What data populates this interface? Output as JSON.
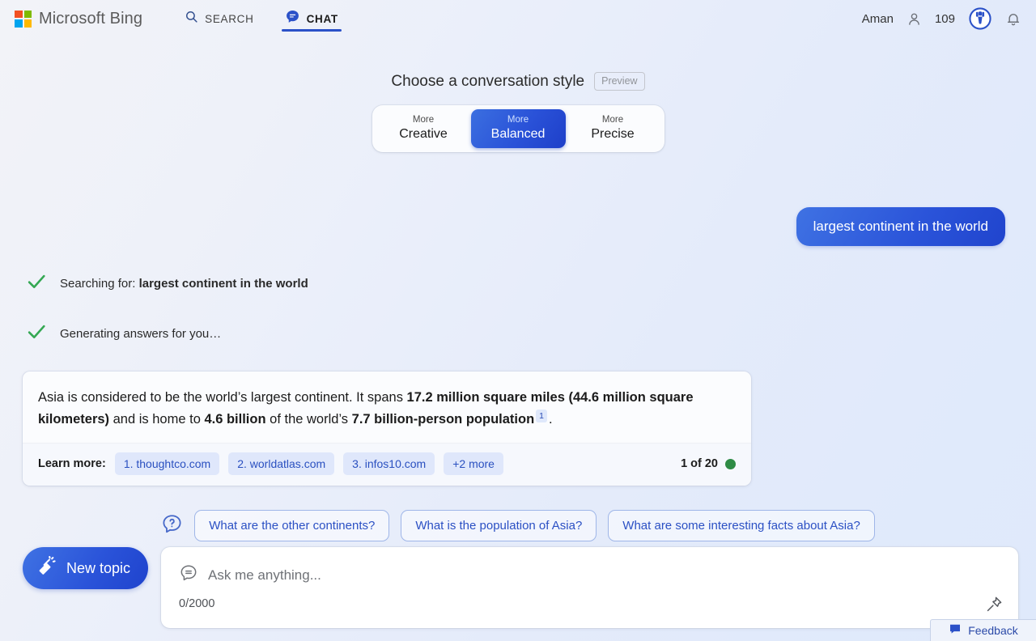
{
  "header": {
    "brand_name": "Microsoft Bing",
    "logo_icon": "microsoft-squares-logo",
    "tabs": [
      {
        "label": "SEARCH",
        "icon": "search-icon",
        "active": false
      },
      {
        "label": "CHAT",
        "icon": "chat-bubble-icon",
        "active": true
      }
    ],
    "account_name": "Aman",
    "account_icon": "person-icon",
    "rewards_count": "109",
    "rewards_icon": "rewards-medal-icon",
    "notifications_icon": "bell-icon"
  },
  "style_selector": {
    "heading": "Choose a conversation style",
    "preview_badge": "Preview",
    "options": [
      {
        "sub": "More",
        "main": "Creative",
        "selected": false
      },
      {
        "sub": "More",
        "main": "Balanced",
        "selected": true
      },
      {
        "sub": "More",
        "main": "Precise",
        "selected": false
      }
    ]
  },
  "conversation": {
    "user_message": "largest continent in the world",
    "status_steps": [
      {
        "icon": "check-icon",
        "prefix": "Searching for: ",
        "bold": "largest continent in the world"
      },
      {
        "icon": "check-icon",
        "prefix": "Generating answers for you…",
        "bold": ""
      }
    ],
    "answer": {
      "part1": "Asia is considered to be the world’s largest continent. It spans ",
      "bold1": "17.2 million square miles (44.6 million square kilometers)",
      "part2": " and is home to ",
      "bold2": "4.6 billion",
      "part3": " of the world’s ",
      "bold3": "7.7 billion-person population",
      "citation": "1",
      "part4": "."
    },
    "learn_more_label": "Learn more:",
    "sources": [
      "1. thoughtco.com",
      "2. worldatlas.com",
      "3. infos10.com",
      "+2 more"
    ],
    "counter": "1 of 20",
    "counter_dot_color": "#2e8b45"
  },
  "suggestions": {
    "icon": "question-bubble-icon",
    "chips": [
      "What are the other continents?",
      "What is the population of Asia?",
      "What are some interesting facts about Asia?"
    ]
  },
  "composer": {
    "new_topic_label": "New topic",
    "new_topic_icon": "broom-icon",
    "input_icon": "chat-bubble-outline-icon",
    "input_placeholder": "Ask me anything...",
    "input_value": "",
    "char_counter": "0/2000",
    "pin_icon": "pin-icon"
  },
  "feedback": {
    "label": "Feedback",
    "icon": "feedback-bubble-icon"
  },
  "colors": {
    "accent_blue": "#2a53d9",
    "chip_blue": "#2a50c0",
    "chip_bg": "#dfe7fb",
    "check_green": "#34a853",
    "status_green": "#2e8b45"
  }
}
